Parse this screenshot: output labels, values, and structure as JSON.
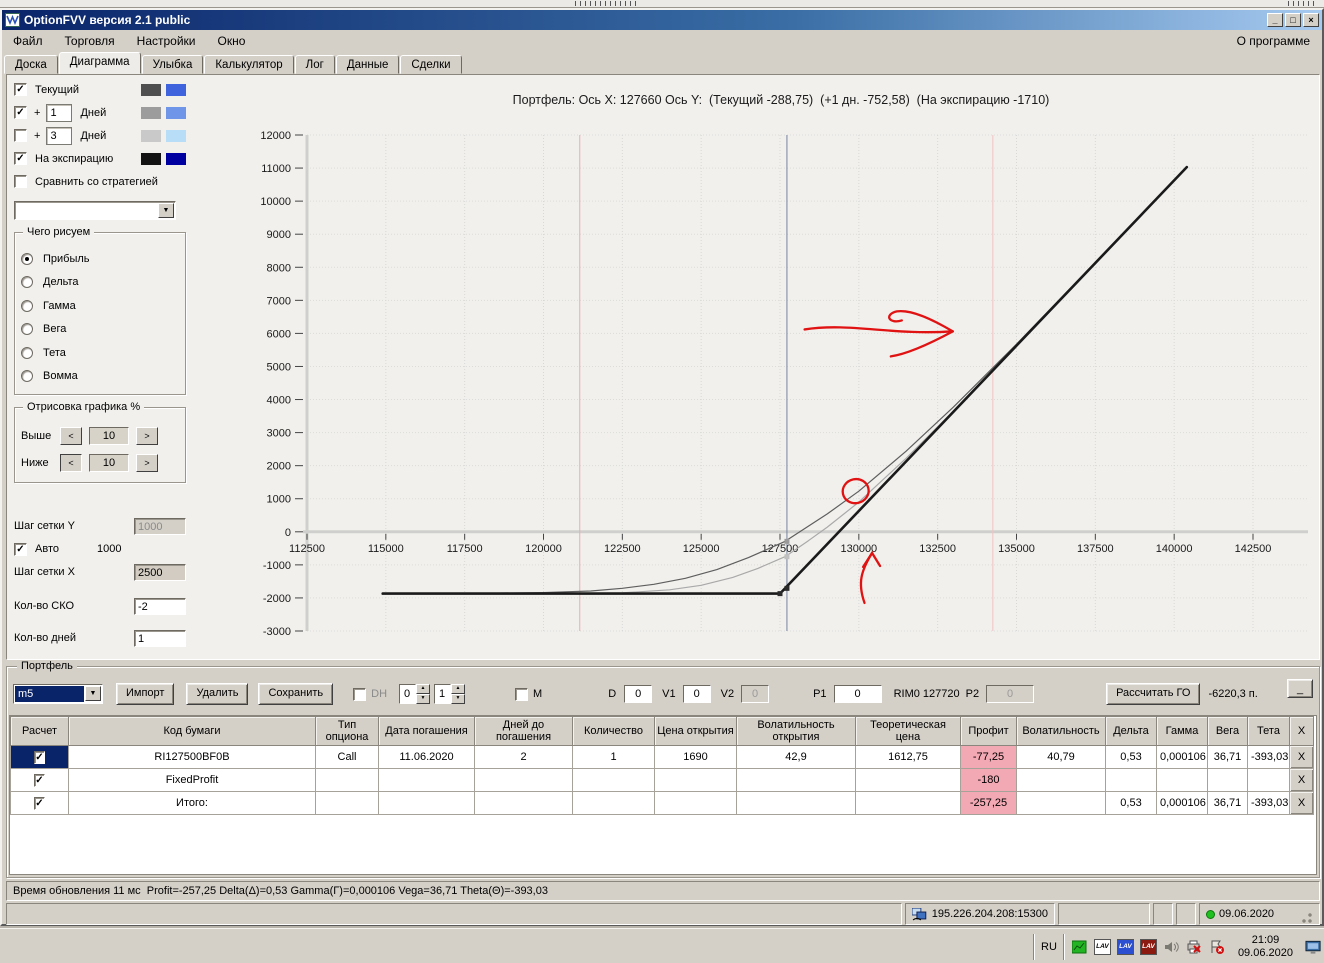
{
  "window": {
    "title": "OptionFVV версия 2.1 public",
    "controls": {
      "minimize": "_",
      "maximize": "□",
      "close": "×"
    }
  },
  "menu": {
    "items": [
      "Файл",
      "Торговля",
      "Настройки",
      "Окно"
    ],
    "right_item": "О программе"
  },
  "tabs": {
    "items": [
      "Доска",
      "Диаграмма",
      "Улыбка",
      "Калькулятор",
      "Лог",
      "Данные",
      "Сделки"
    ],
    "active": "Диаграмма"
  },
  "sidebar": {
    "series_toggles": [
      {
        "label": "Текущий",
        "checked": true,
        "swatches": [
          "#4f4f4f",
          "#3f62dd"
        ]
      },
      {
        "label": "Дней",
        "prefix": "+",
        "box": "1",
        "checked": true,
        "swatches": [
          "#9c9c9c",
          "#6f95e9"
        ]
      },
      {
        "label": "Дней",
        "prefix": "+",
        "box": "3",
        "checked": false,
        "swatches": [
          "#c9c9c9",
          "#b8ddf6"
        ]
      },
      {
        "label": "На экспирацию",
        "checked": true,
        "swatches": [
          "#131313",
          "#0000a0"
        ]
      },
      {
        "label": "Сравнить со стратегией",
        "checked": false
      }
    ],
    "strategy_dropdown_value": "",
    "draw_group": {
      "title": "Чего рисуем",
      "options": [
        "Прибыль",
        "Дельта",
        "Гамма",
        "Вега",
        "Тета",
        "Вомма"
      ],
      "selected": "Прибыль"
    },
    "render_group": {
      "title": "Отрисовка графика %",
      "rows": [
        {
          "label": "Выше",
          "value": "10"
        },
        {
          "label": "Ниже",
          "value": "10"
        }
      ]
    },
    "grid_y_label": "Шаг сетки Y",
    "grid_y_value": "1000",
    "auto_label": "Авто",
    "auto_checked": true,
    "auto_value": "1000",
    "grid_x_label": "Шаг сетки X",
    "grid_x_value": "2500",
    "sko_label": "Кол-во СКО",
    "sko_value": "-2",
    "days_label": "Кол-во дней",
    "days_value": "1"
  },
  "chart_data": {
    "type": "line",
    "title": "Портфель: Ось X: 127660 Ось Y:  (Текущий -288,75)  (+1 дн. -752,58)  (На экспирацию -1710)",
    "xlim": [
      112500,
      142500
    ],
    "ylim": [
      -3000,
      12000
    ],
    "x_ticks": [
      112500,
      115000,
      117500,
      120000,
      122500,
      125000,
      127500,
      130000,
      132500,
      135000,
      137500,
      140000,
      142500
    ],
    "y_ticks": [
      12000,
      11000,
      10000,
      9000,
      8000,
      7000,
      6000,
      5000,
      4000,
      3000,
      2000,
      1000,
      0,
      -1000,
      -2000,
      -3000
    ],
    "grid": true,
    "series": [
      {
        "name": "+1 Дней",
        "color": "#a9a9a9",
        "width": 1.2,
        "points": [
          [
            114900,
            -1870
          ],
          [
            120000,
            -1868
          ],
          [
            122500,
            -1848
          ],
          [
            124000,
            -1754
          ],
          [
            125000,
            -1618
          ],
          [
            126000,
            -1380
          ],
          [
            126800,
            -1106
          ],
          [
            127660,
            -753
          ],
          [
            128400,
            -268
          ],
          [
            129000,
            141
          ],
          [
            130000,
            897
          ],
          [
            131500,
            2222
          ],
          [
            133000,
            3654
          ],
          [
            135000,
            5628
          ],
          [
            137500,
            8132
          ],
          [
            139000,
            9626
          ],
          [
            140400,
            11030
          ]
        ]
      },
      {
        "name": "Текущий",
        "color": "#5e5e5e",
        "width": 1.2,
        "points": [
          [
            114900,
            -1869
          ],
          [
            118000,
            -1864
          ],
          [
            120000,
            -1840
          ],
          [
            121500,
            -1791
          ],
          [
            122500,
            -1709
          ],
          [
            123500,
            -1587
          ],
          [
            124500,
            -1407
          ],
          [
            125500,
            -1142
          ],
          [
            126500,
            -781
          ],
          [
            127660,
            -289
          ],
          [
            128300,
            106
          ],
          [
            129000,
            542
          ],
          [
            130000,
            1228
          ],
          [
            131500,
            2436
          ],
          [
            133000,
            3771
          ],
          [
            135000,
            5673
          ],
          [
            137500,
            8148
          ],
          [
            139000,
            9636
          ],
          [
            140400,
            11032
          ]
        ]
      },
      {
        "name": "На экспирацию",
        "color": "#1a1a1a",
        "width": 2.6,
        "points": [
          [
            114900,
            -1870
          ],
          [
            127500,
            -1870
          ],
          [
            140400,
            11030
          ]
        ]
      }
    ],
    "markers": [
      {
        "x": 127500,
        "y": -1870,
        "color": "#2a2a2a"
      },
      {
        "x": 127720,
        "y": -1710,
        "color": "#2a2a2a"
      },
      {
        "x": 127720,
        "y": -753,
        "color": "#c0c0c0"
      },
      {
        "x": 127720,
        "y": -289,
        "color": "#9a9a9a"
      }
    ],
    "vlines": [
      {
        "x": 121150,
        "color": "#eaacac"
      },
      {
        "x": 127720,
        "color": "#76849e"
      },
      {
        "x": 134250,
        "color": "#f2c2c2"
      }
    ],
    "annotations": {
      "color": "#e01212",
      "circle": {
        "x": 129900,
        "y": 1230
      },
      "arrow_right": {
        "tail": {
          "x": 128280,
          "y": 6120
        },
        "tip": {
          "x": 132980,
          "y": 6060
        }
      },
      "arrow_up": {
        "tail": {
          "x": 130180,
          "y": -2150
        },
        "tip": {
          "x": 130420,
          "y": -640
        }
      }
    }
  },
  "portfolio": {
    "legend": "Портфель",
    "combo_value": "m5",
    "buttons": {
      "import": "Импорт",
      "delete": "Удалить",
      "save": "Сохранить"
    },
    "dh_label": "DH",
    "dh_checked": false,
    "spinner1": "0",
    "spinner2": "1",
    "m_label": "М",
    "m_checked": false,
    "d_label": "D",
    "d_value": "0",
    "v1_label": "V1",
    "v1_value": "0",
    "v2_label": "V2",
    "v2_value": "0",
    "p1_label": "P1",
    "p1_value": "0",
    "rim_label": "RIM0 127720",
    "p2_label": "P2",
    "p2_value": "0",
    "calc_button": "Рассчитать ГО",
    "go_value": "-6220,3 п.",
    "small_minimize": "_"
  },
  "table": {
    "headers": [
      "Расчет",
      "Код бумаги",
      "Тип опциона",
      "Дата погашения",
      "Дней до погашения",
      "Количество",
      "Цена открытия",
      "Волатильность открытия",
      "Теоретическая цена",
      "Профит",
      "Волатильность",
      "Дельта",
      "Гамма",
      "Вега",
      "Тета",
      "X"
    ],
    "profit_color": "#f3a9b3",
    "rows": [
      {
        "checked": true,
        "selected": true,
        "cells": [
          "RI127500BF0B",
          "Call",
          "11.06.2020",
          "2",
          "1",
          "1690",
          "42,9",
          "1612,75",
          "-77,25",
          "40,79",
          "0,53",
          "0,000106",
          "36,71",
          "-393,03"
        ]
      },
      {
        "checked": true,
        "selected": false,
        "cells": [
          "FixedProfit",
          "",
          "",
          "",
          "",
          "",
          "",
          "",
          "-180",
          "",
          "",
          "",
          "",
          ""
        ]
      },
      {
        "checked": true,
        "selected": false,
        "cells": [
          "Итого:",
          "",
          "",
          "",
          "",
          "",
          "",
          "",
          "-257,25",
          "",
          "0,53",
          "0,000106",
          "36,71",
          "-393,03"
        ]
      }
    ]
  },
  "status": {
    "line1": "Время обновления 11 мс  Profit=-257,25 Delta(Δ)=0,53 Gamma(Γ)=0,000106 Vega=36,71 Theta(Θ)=-393,03",
    "ip": "195.226.204.208:15300",
    "date": "09.06.2020"
  },
  "taskbar": {
    "lang": "RU",
    "time": "21:09",
    "date": "09.06.2020",
    "tray_icons": [
      "chart-green-icon",
      "lav-white-icon",
      "lav-blue-icon",
      "lav-red-icon",
      "speaker-icon",
      "printer-error-icon",
      "flag-error-icon",
      "show-desktop-icon"
    ]
  }
}
